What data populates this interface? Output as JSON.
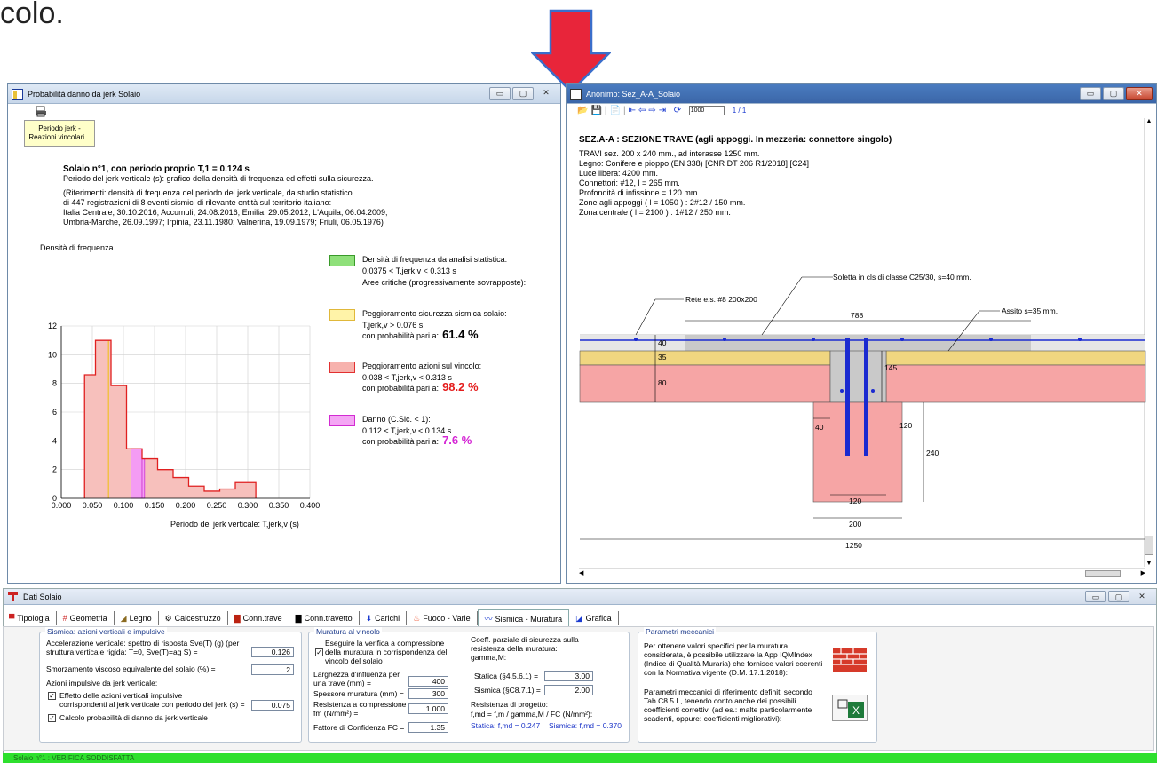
{
  "top_text": "colo.",
  "left_window": {
    "title": "Probabilità danno da jerk Solaio",
    "button_line1": "Periodo jerk -",
    "button_line2": "Reazioni vincolari...",
    "heading": "Solaio n°1, con periodo proprio T,1 = 0.124 s",
    "subheading": "Periodo del jerk verticale (s): grafico della densità di frequenza ed effetti sulla sicurezza.",
    "ref_lines": [
      "(Riferimenti: densità di frequenza del periodo del jerk verticale, da studio statistico",
      "di 447 registrazioni di 8 eventi sismici di rilevante entità sul territorio italiano:",
      "Italia Centrale, 30.10.2016; Accumuli, 24.08.2016; Emilia, 29.05.2012; L'Aquila, 06.04.2009;",
      "Umbria-Marche, 26.09.1997; Irpinia, 23.11.1980; Valnerina, 19.09.1979; Friuli, 06.05.1976)"
    ],
    "legend": [
      {
        "color": "#8fe07a",
        "border": "#3a9a2a",
        "lines": [
          "Densità di frequenza da analisi statistica:",
          "0.0375 < T,jerk,v < 0.313 s",
          "Aree critiche (progressivamente sovrapposte):"
        ],
        "prob": "",
        "prob_color": ""
      },
      {
        "color": "#fff3a8",
        "border": "#e0b83a",
        "lines": [
          "Peggioramento sicurezza sismica solaio:",
          "T,jerk,v > 0.076 s",
          "con probabilità pari a:"
        ],
        "prob": "61.4 %",
        "prob_color": "#000000"
      },
      {
        "color": "#f7b2ad",
        "border": "#e23030",
        "lines": [
          "Peggioramento azioni sul vincolo:",
          "0.038 < T,jerk,v < 0.313 s",
          "con probabilità pari a:"
        ],
        "prob": "98.2 %",
        "prob_color": "#e41c1c"
      },
      {
        "color": "#f4a6f4",
        "border": "#d22bd2",
        "lines": [
          "Danno (C.Sic. < 1):",
          "0.112 < T,jerk,v < 0.134 s",
          "con probabilità pari a:"
        ],
        "prob": "7.6 %",
        "prob_color": "#d424d4"
      }
    ]
  },
  "chart_data": {
    "type": "bar",
    "title": "",
    "ylabel": "Densità di frequenza",
    "xlabel": "Periodo del jerk verticale: T,jerk,v (s)",
    "xlim": [
      0,
      0.4
    ],
    "ylim": [
      0,
      12
    ],
    "xticks": [
      "0.000",
      "0.050",
      "0.100",
      "0.150",
      "0.200",
      "0.250",
      "0.300",
      "0.350",
      "0.400"
    ],
    "yticks": [
      "0",
      "2",
      "4",
      "6",
      "8",
      "10",
      "12"
    ],
    "bins": [
      [
        0.0375,
        0.055,
        8.6
      ],
      [
        0.055,
        0.08,
        11.0
      ],
      [
        0.08,
        0.105,
        7.85
      ],
      [
        0.105,
        0.13,
        3.45
      ],
      [
        0.13,
        0.155,
        2.75
      ],
      [
        0.155,
        0.18,
        2.0
      ],
      [
        0.18,
        0.205,
        1.45
      ],
      [
        0.205,
        0.23,
        0.85
      ],
      [
        0.23,
        0.255,
        0.5
      ],
      [
        0.255,
        0.28,
        0.65
      ],
      [
        0.28,
        0.313,
        1.1
      ]
    ],
    "yellow_from": 0.076,
    "magenta_range": [
      0.112,
      0.134
    ],
    "grid": true
  },
  "right_window": {
    "title": "Anonimo: Sez_A-A_Solaio",
    "zoom": "1000",
    "page": "1 / 1",
    "section_title": "SEZ.A-A : SEZIONE TRAVE (agli appoggi. In mezzeria: connettore singolo)",
    "lines": [
      "TRAVI sez. 200 x 240 mm., ad interasse 1250 mm.",
      "Legno: Conifere e pioppo (EN 338) [CNR DT 206 R1/2018] [C24]",
      "Luce libera: 4200 mm.",
      "Connettori: #12, l = 265 mm.",
      "Profondità di infissione = 120 mm.",
      "Zone agli appoggi ( l = 1050 ) :  2#12 / 150 mm.",
      "Zona centrale ( l = 2100 ) :  1#12 / 250 mm."
    ],
    "label_soletta": "Soletta in cls di classe C25/30, s=40 mm.",
    "label_rete": "Rete e.s. #8  200x200",
    "label_assito": "Assito s=35  mm.",
    "dims": {
      "d788": "788",
      "d40": "40",
      "d35": "35",
      "d80": "80",
      "d145": "145",
      "d40b": "40",
      "d120a": "120",
      "d240": "240",
      "d120b": "120",
      "d200": "200",
      "d1250": "1250"
    }
  },
  "bottom_window": {
    "title": "Dati Solaio",
    "tabs": [
      "Tipologia",
      "Geometria",
      "Legno",
      "Calcestruzzo",
      "Conn.trave",
      "Conn.travetto",
      "Carichi",
      "Fuoco - Varie",
      "Sismica - Muratura",
      "Grafica"
    ],
    "selected_tab": "Sismica - Muratura",
    "g1": {
      "title": "Sismica: azioni verticali e impulsive",
      "acc_l1": "Accelerazione verticale: spettro di risposta Sve(T) (g) (per",
      "acc_l2": "struttura verticale rigida: T=0, Sve(T)=ag S) =",
      "acc_val": "0.126",
      "smorz": "Smorzamento viscoso equivalente del solaio (%) =",
      "smorz_val": "2",
      "azioni": "Azioni impulsive da jerk verticale:",
      "eff_l1": "Effetto delle azioni verticali impulsive",
      "eff_l2": "corrispondenti al jerk verticale con periodo del jerk (s) =",
      "eff_val": "0.075",
      "calc": "Calcolo probabilità di danno da jerk verticale"
    },
    "g2": {
      "title": "Muratura al vincolo",
      "ver_l1": "Eseguire la verifica a compressione",
      "ver_l2": "della muratura in corrispondenza del",
      "ver_l3": "vincolo del solaio",
      "larg_l1": "Larghezza d'influenza per",
      "larg_l2": "una trave (mm) =",
      "larg_val": "400",
      "spess": "Spessore muratura (mm) =",
      "spess_val": "300",
      "res_l1": "Resistenza a compressione",
      "res_l2": "fm (N/mm²) =",
      "res_val": "1.000",
      "fc": "Fattore di Confidenza FC =",
      "fc_val": "1.35",
      "coef_l1": "Coeff. parziale di sicurezza sulla",
      "coef_l2": "resistenza della muratura:",
      "coef_l3": "gamma,M:",
      "stat": "Statica (§4.5.6.1) =",
      "stat_val": "3.00",
      "sism": "Sismica (§C8.7.1) =",
      "sism_val": "2.00",
      "rp": "Resistenza di progetto:",
      "rp_f": "f,md = f,m / gamma,M / FC (N/mm²):",
      "res_stat": "Statica: f,md = 0.247",
      "res_sism": "Sismica: f,md = 0.370"
    },
    "g3": {
      "title": "Parametri meccanici",
      "p1": [
        "Per ottenere valori specifici per la muratura",
        "considerata, è possibile utilizzare la App IQMIndex",
        "(Indice di Qualità Muraria) che fornisce valori coerenti",
        "con la Normativa vigente (D.M. 17.1.2018):"
      ],
      "p2": [
        "Parametri meccanici di riferimento definiti secondo",
        "Tab.C8.5.I , tenendo conto anche dei possibili",
        "coefficienti correttivi (ad es.: malte particolarmente",
        "scadenti, oppure: coefficienti migliorativi):"
      ]
    },
    "status": "Solaio n°1 : VERIFICA SODDISFATTA"
  }
}
